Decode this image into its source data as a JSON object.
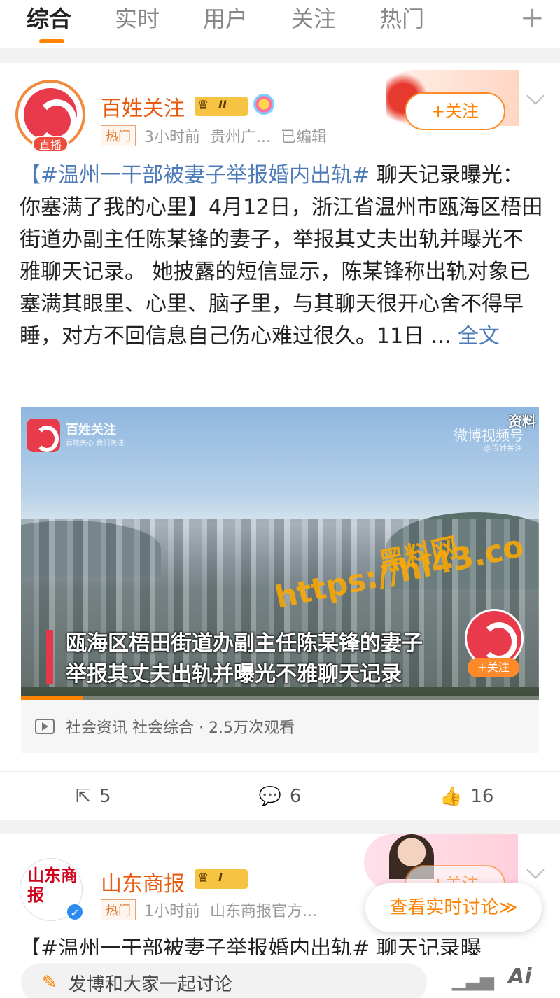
{
  "tabs": [
    "综合",
    "实时",
    "用户",
    "关注",
    "热门"
  ],
  "tabs_add": "+",
  "post1": {
    "author": "百姓关注",
    "rank": "II",
    "live_badge": "直播",
    "hot_tag": "热门",
    "time": "3小时前",
    "location": "贵州广...",
    "edited": "已编辑",
    "follow": "+关注",
    "hashtag": "【#温州一干部被妻子举报婚内出轨#",
    "body": " 聊天记录曝光：你塞满了我的心里】4月12日，浙江省温州市瓯海区梧田街道办副主任陈某锋的妻子，举报其丈夫出轨并曝光不雅聊天记录。 她披露的短信显示，陈某锋称出轨对象已塞满其眼里、心里、脑子里，与其聊天很开心舍不得早睡，对方不回信息自己伤心难过很久。11日 ...",
    "read_more": " 全文",
    "video": {
      "brand": "百姓关注",
      "slogan": "百姓关心 我们关注",
      "material": "资料",
      "weibo": "微博视频号",
      "weibo_sub": "@百姓关注",
      "subtitle_line1": "瓯海区梧田街道办副主任陈某锋的妻子",
      "subtitle_line2": "举报其丈夫出轨并曝光不雅聊天记录",
      "watermark1": "黑料网",
      "watermark2": "https://hl43.co",
      "follow": "+关注",
      "progress": 0.12
    },
    "video_meta": "社会资讯 社会综合 · 2.5万次观看",
    "actions": {
      "repost": "5",
      "comment": "6",
      "like": "16"
    }
  },
  "post2": {
    "author": "山东商报",
    "rank": "I",
    "avatar_text": "山东商报",
    "hot_tag": "热门",
    "time": "1小时前",
    "source": "山东商报官方...",
    "follow": "+关注",
    "body": "【#温州一干部被妻子举报婚内出轨# 聊天记录曝"
  },
  "live_discuss": "查看实时讨论≫",
  "bottom": {
    "compose_placeholder": "发博和大家一起讨论",
    "ai": "Ai"
  },
  "colors": {
    "accent": "#ff8200",
    "hashtag": "#4d7bb8",
    "author": "#e8590c"
  }
}
